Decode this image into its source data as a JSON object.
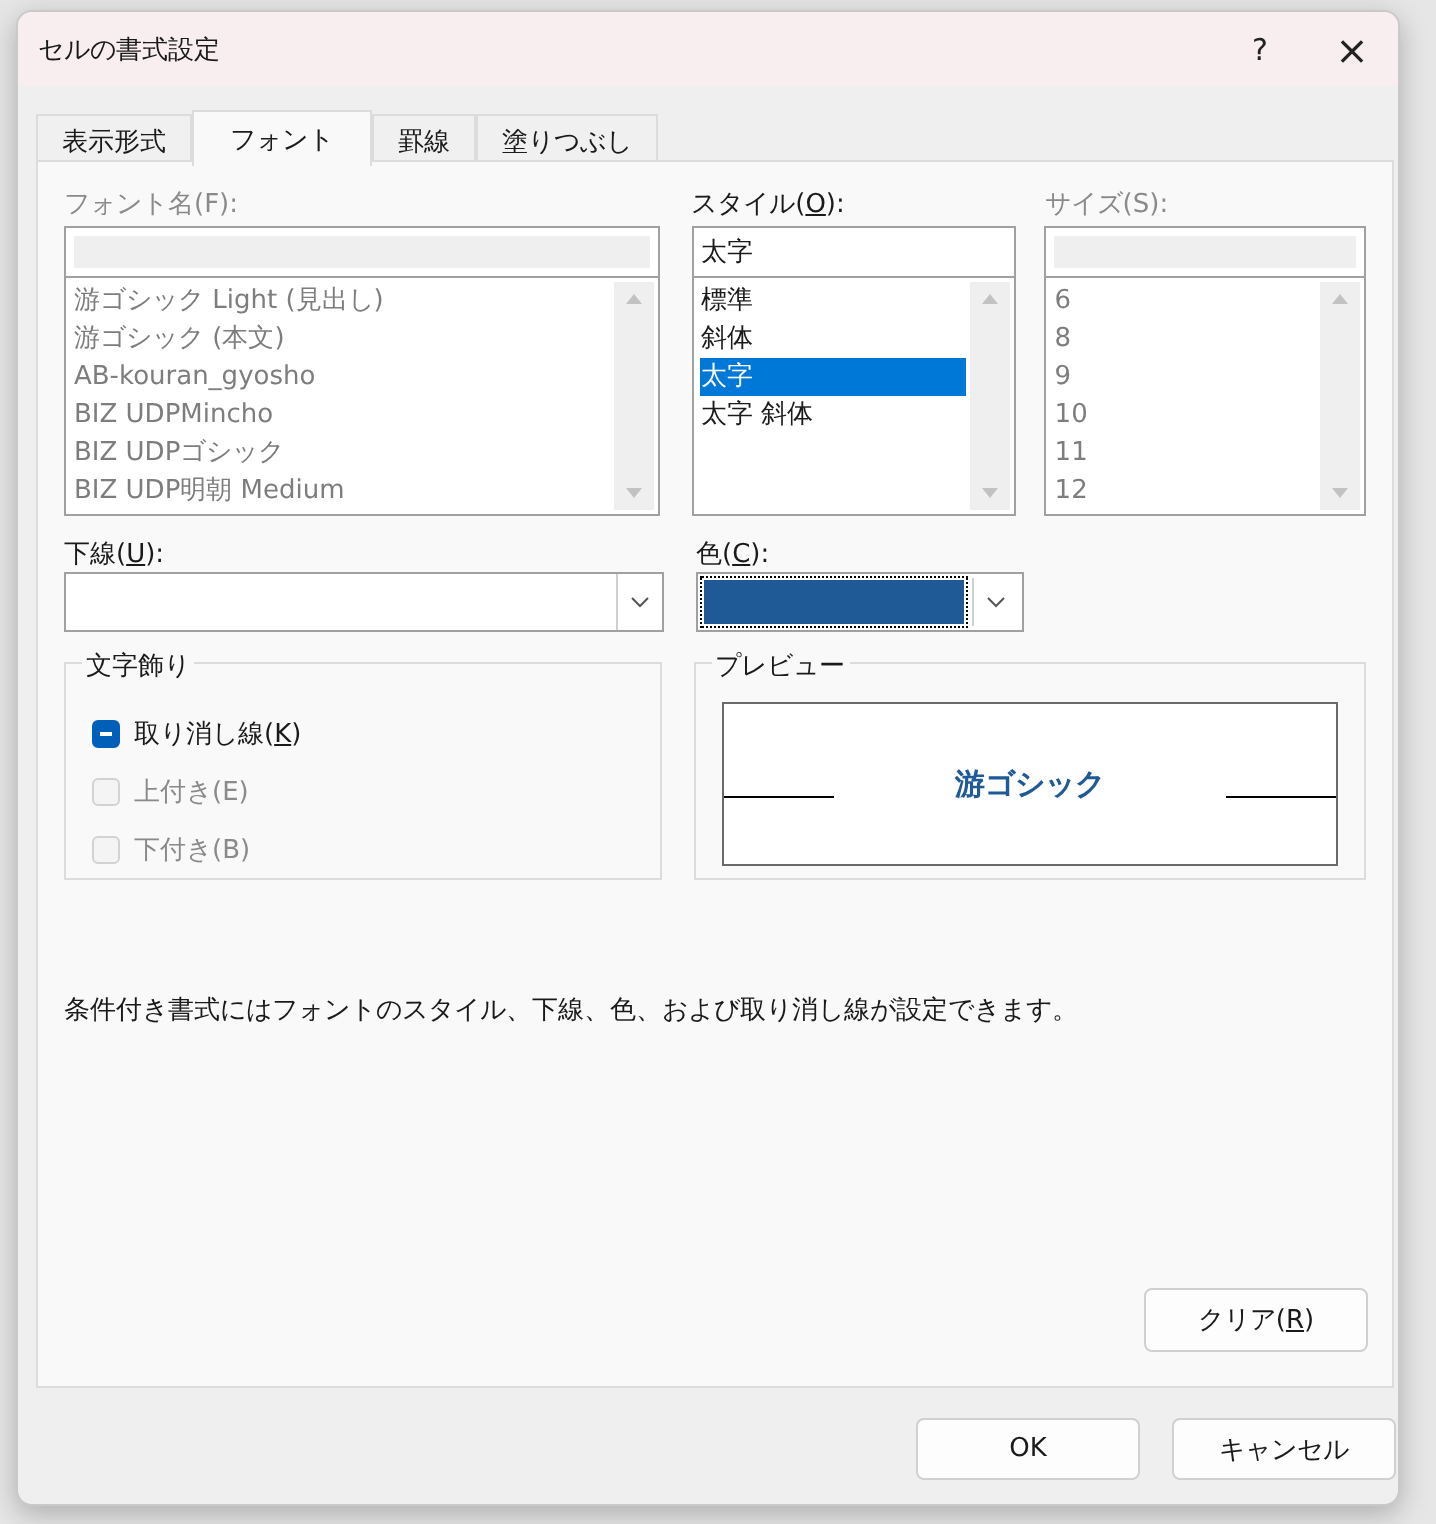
{
  "window": {
    "title": "セルの書式設定",
    "help": "?",
    "close": "×"
  },
  "tabs": [
    {
      "label": "表示形式",
      "selected": false
    },
    {
      "label": "フォント",
      "selected": true
    },
    {
      "label": "罫線",
      "selected": false
    },
    {
      "label": "塗りつぶし",
      "selected": false
    }
  ],
  "font_name": {
    "label": "フォント名(F):",
    "disabled": true,
    "items": [
      {
        "text": "游ゴシック Light (見出し)",
        "selected": false
      },
      {
        "text": "游ゴシック (本文)",
        "selected": false
      },
      {
        "text": "AB-kouran_gyosho",
        "selected": false
      },
      {
        "text": "BIZ UDPMincho",
        "selected": false
      },
      {
        "text": "BIZ UDPゴシック",
        "selected": false
      },
      {
        "text": "BIZ UDP明朝 Medium",
        "selected": false
      }
    ]
  },
  "style": {
    "label": "スタイル(",
    "mnemonic": "O",
    "label_end": "):",
    "disabled": false,
    "value": "太字",
    "items": [
      {
        "text": "標準",
        "selected": false
      },
      {
        "text": "斜体",
        "selected": false
      },
      {
        "text": "太字",
        "selected": true
      },
      {
        "text": "太字 斜体",
        "selected": false
      }
    ]
  },
  "size": {
    "label": "サイズ(S):",
    "disabled": true,
    "items": [
      {
        "text": "6",
        "selected": false
      },
      {
        "text": "8",
        "selected": false
      },
      {
        "text": "9",
        "selected": false
      },
      {
        "text": "10",
        "selected": false
      },
      {
        "text": "11",
        "selected": false
      },
      {
        "text": "12",
        "selected": false
      }
    ]
  },
  "underline": {
    "label": "下線(",
    "mnemonic": "U",
    "label_end": "):"
  },
  "color": {
    "label": "色(",
    "mnemonic": "C",
    "label_end": "):",
    "color": "#1f5a96"
  },
  "effects": {
    "title": "文字飾り",
    "items": [
      {
        "label": "取り消し線(",
        "mnemonic": "K",
        "label_end": ")",
        "indeterminate": true,
        "disabled": false
      },
      {
        "label": "上付き(E)",
        "indeterminate": false,
        "disabled": true
      },
      {
        "label": "下付き(B)",
        "indeterminate": false,
        "disabled": true
      }
    ]
  },
  "preview": {
    "title": "プレビュー",
    "sample": "游ゴシック"
  },
  "note": "条件付き書式にはフォントのスタイル、下線、色、および取り消し線が設定できます。",
  "clear_button": {
    "label": "クリア(",
    "mnemonic": "R",
    "label_end": ")"
  },
  "buttons": [
    {
      "label": "OK"
    },
    {
      "label": "キャンセル"
    }
  ]
}
